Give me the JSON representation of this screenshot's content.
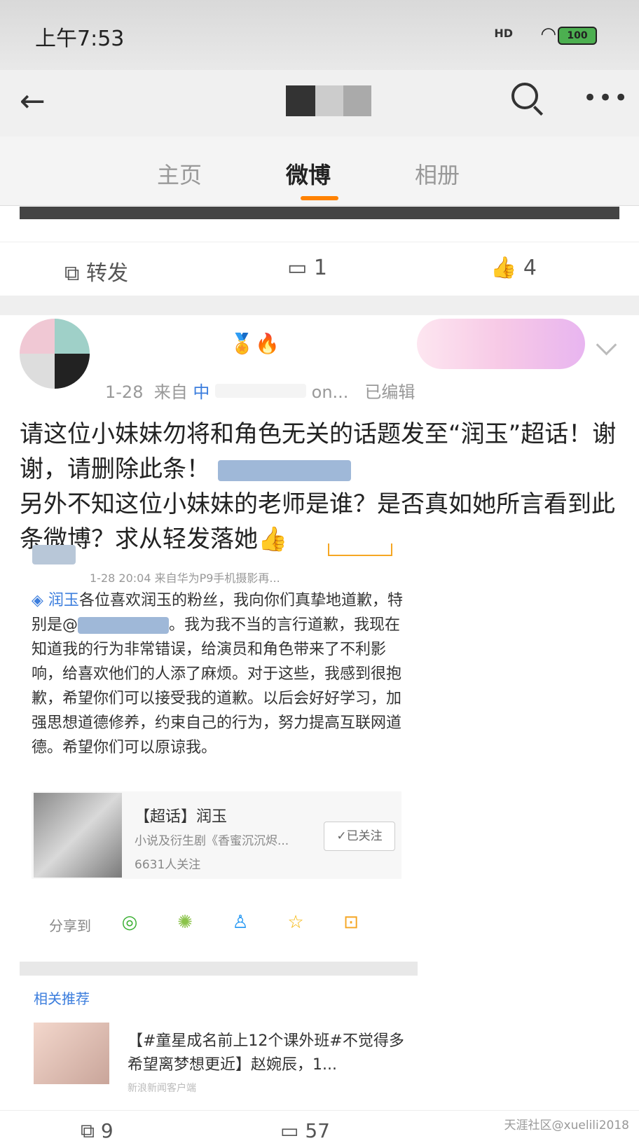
{
  "status_bar": {
    "time": "上午7:53",
    "signal": "HD",
    "battery": "100"
  },
  "nav": {
    "back_icon": "←",
    "more_icon": "•••"
  },
  "tabs": [
    {
      "label": "主页"
    },
    {
      "label": "微博",
      "active": true
    },
    {
      "label": "相册"
    }
  ],
  "prev_post_actions": {
    "repost_label": "转发",
    "comment_count": "1",
    "like_count": "4"
  },
  "post": {
    "date": "1-28",
    "source_prefix": "来自",
    "source_partial": "中",
    "source_suffix": "on...",
    "edited": "已编辑",
    "text_line1": "请这位小妹妹勿将和角色无关的话题发至“润玉”超话！谢谢，请删除此条！",
    "text_line2": "另外不知这位小妹妹的老师是谁？是否真如她所言看到此条微博？求从轻发落她👍"
  },
  "embedded": {
    "meta": "1-28 20:04  来自华为P9手机摄影再...",
    "topic_link": "润玉",
    "text_a": "各位喜欢润玉的粉丝，我向你们真挚地道歉，特别是@",
    "text_b": "。我为我不当的言行道歉，我现在知道我的行为非常错误，给演员和角色带来了不利影响，给喜欢他们的人添了麻烦。对于这些，我感到很抱歉，希望你们可以接受我的道歉。以后会好好学习，加强思想道德修养，约束自己的行为，努力提高互联网道德。希望你们可以原谅我。",
    "topic_card": {
      "title": "【超话】润玉",
      "subtitle": "小说及衍生剧《香蜜沉沉烬...",
      "followers": "6631人关注",
      "follow_button": "✓已关注"
    },
    "share_label": "分享到",
    "related_label": "相关推荐",
    "related_text": "【#童星成名前上12个课外班#不觉得多 希望离梦想更近】赵婉辰，1...",
    "related_source": "新浪新闻客户端"
  },
  "bottom_actions": {
    "repost_count": "9",
    "comment_count": "57"
  },
  "watermark": "天涯社区@xuelili2018",
  "colors": {
    "accent": "#ff8200",
    "link": "#3b7ddd"
  }
}
